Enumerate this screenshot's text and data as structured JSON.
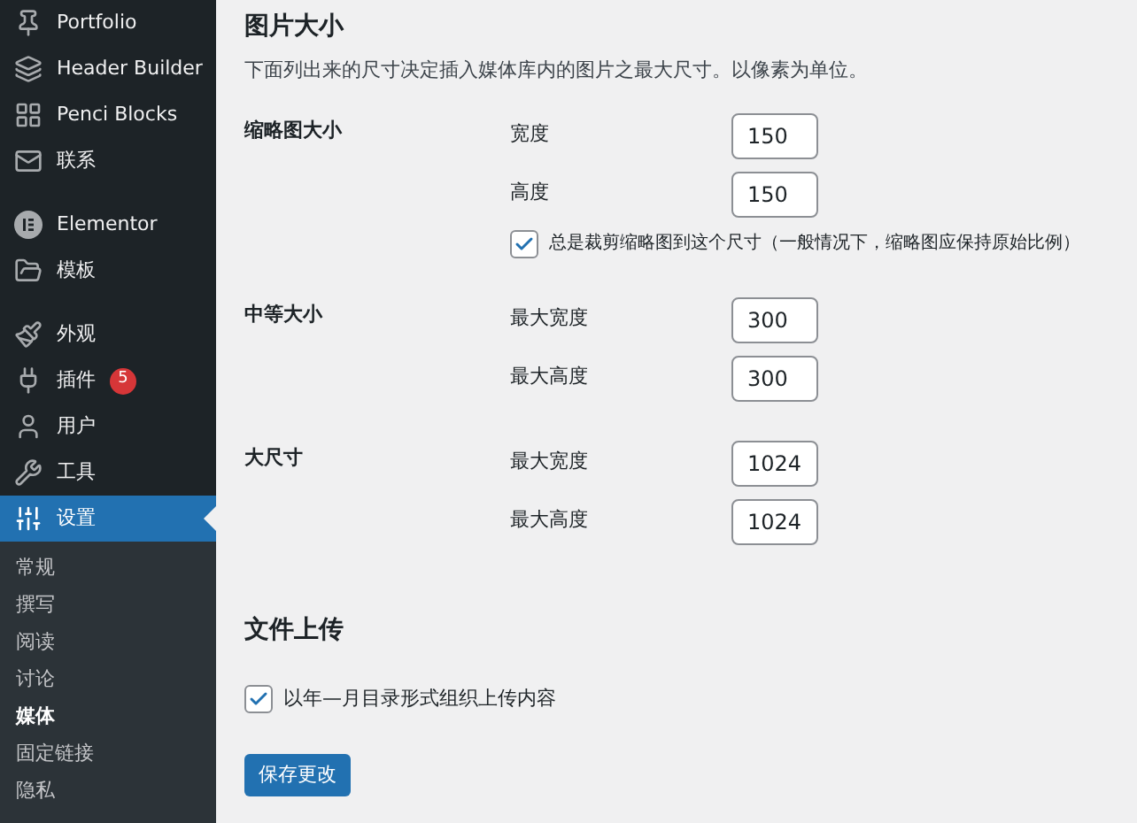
{
  "sidebar": {
    "groups": [
      [
        {
          "label": "Portfolio",
          "selected": false
        },
        {
          "label": "Header Builder",
          "selected": false
        },
        {
          "label": "Penci Blocks",
          "selected": false
        },
        {
          "label": "联系",
          "selected": false
        }
      ],
      [
        {
          "label": "Elementor",
          "selected": false
        },
        {
          "label": "模板",
          "selected": false
        }
      ],
      [
        {
          "label": "外观",
          "selected": false
        },
        {
          "label": "插件",
          "selected": false,
          "badge": "5"
        },
        {
          "label": "用户",
          "selected": false
        },
        {
          "label": "工具",
          "selected": false
        },
        {
          "label": "设置",
          "selected": true
        }
      ]
    ],
    "submenu": [
      {
        "label": "常规",
        "selected": false
      },
      {
        "label": "撰写",
        "selected": false
      },
      {
        "label": "阅读",
        "selected": false
      },
      {
        "label": "讨论",
        "selected": false
      },
      {
        "label": "媒体",
        "selected": true
      },
      {
        "label": "固定链接",
        "selected": false
      },
      {
        "label": "隐私",
        "selected": false
      }
    ]
  },
  "image_sizes": {
    "title": "图片大小",
    "description": "下面列出来的尺寸决定插入媒体库内的图片之最大尺寸。以像素为单位。",
    "rows": [
      {
        "label": "缩略图大小",
        "fields": [
          {
            "label": "宽度",
            "value": "150"
          },
          {
            "label": "高度",
            "value": "150"
          }
        ],
        "checkbox": {
          "label": "总是裁剪缩略图到这个尺寸（一般情况下，缩略图应保持原始比例）",
          "checked": true
        }
      },
      {
        "label": "中等大小",
        "fields": [
          {
            "label": "最大宽度",
            "value": "300"
          },
          {
            "label": "最大高度",
            "value": "300"
          }
        ]
      },
      {
        "label": "大尺寸",
        "fields": [
          {
            "label": "最大宽度",
            "value": "1024"
          },
          {
            "label": "最大高度",
            "value": "1024"
          }
        ]
      }
    ]
  },
  "uploads": {
    "title": "文件上传",
    "checkbox": {
      "label": "以年—月目录形式组织上传内容",
      "checked": true
    }
  },
  "save_button": "保存更改"
}
